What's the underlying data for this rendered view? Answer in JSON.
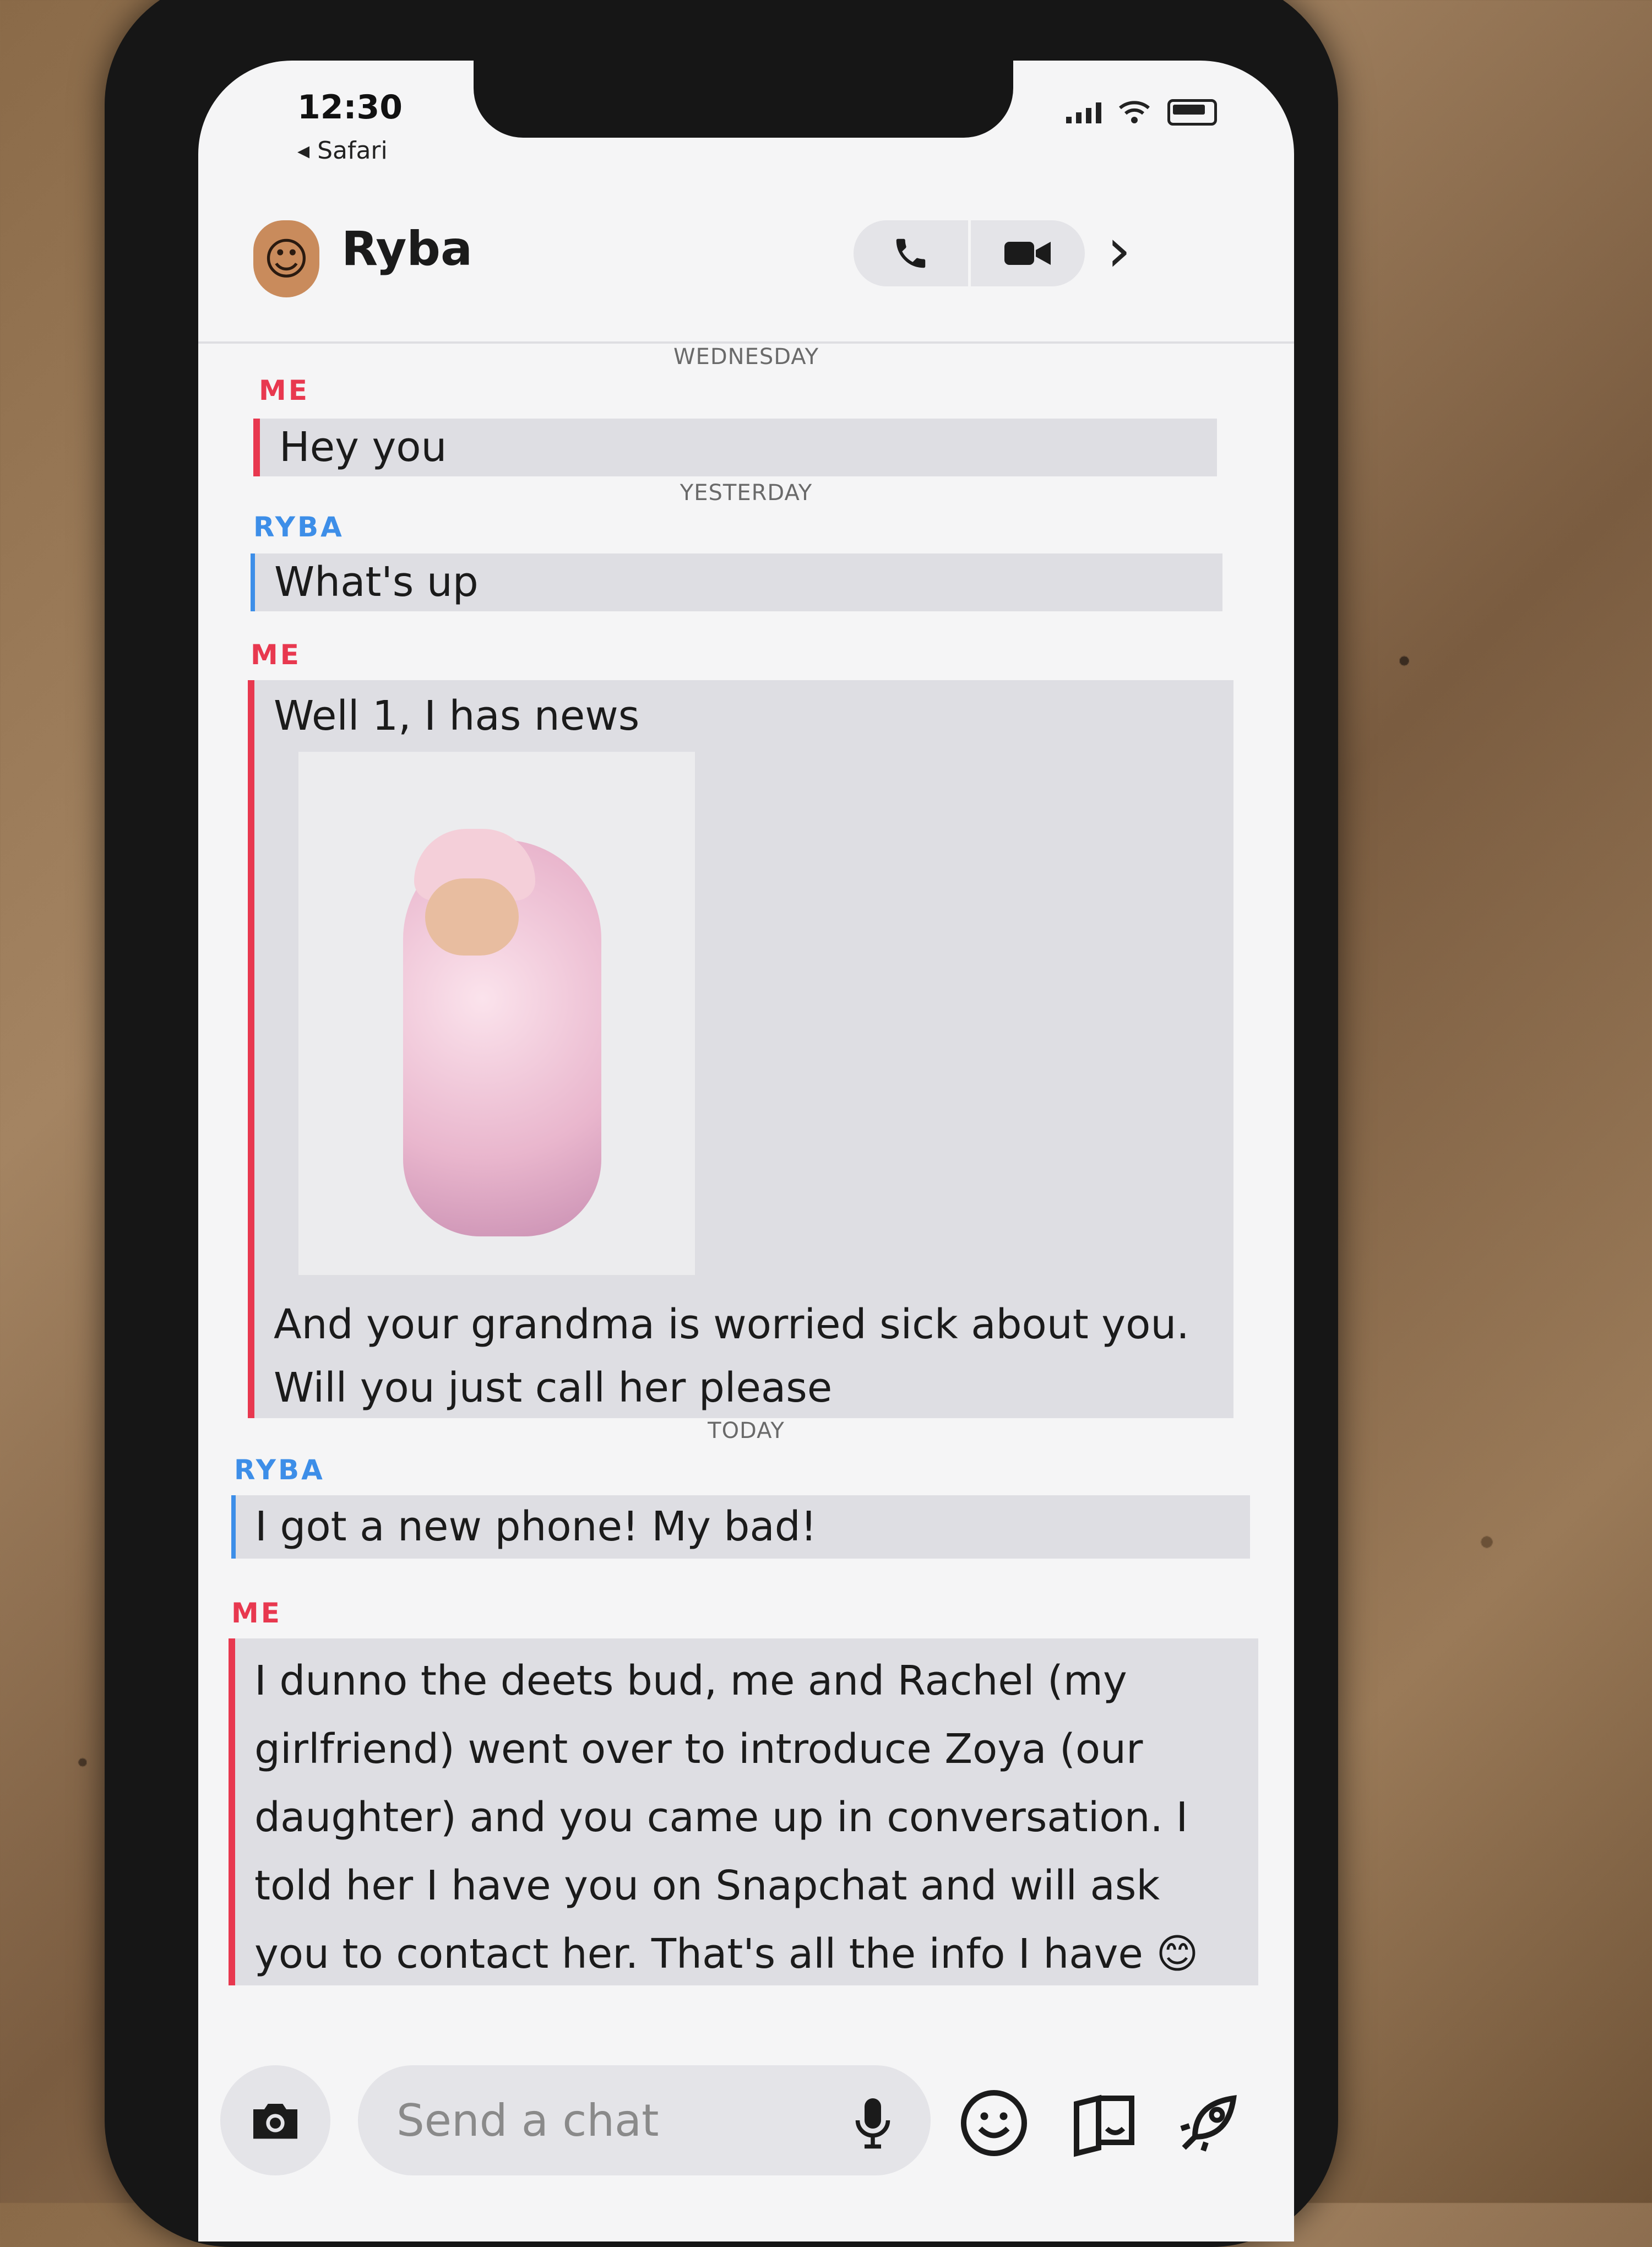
{
  "status_bar": {
    "time": "12:30",
    "back_app": "◂ Safari"
  },
  "header": {
    "contact_name": "Ryba"
  },
  "conversation": {
    "day_labels": [
      "WEDNESDAY",
      "YESTERDAY",
      "TODAY"
    ],
    "sender_me": "ME",
    "sender_ryba": "RYBA",
    "messages": [
      {
        "text": "Hey you"
      },
      {
        "text": "What's up"
      },
      {
        "lines": [
          "Well 1, I has news",
          "And your grandma is worried sick about you.",
          "Will you just call her please"
        ]
      },
      {
        "text": "I got a new phone! My bad!"
      },
      {
        "lines": [
          "I dunno the deets bud, me and Rachel (my",
          "girlfriend) went over to introduce Zoya (our",
          "daughter) and you came up in conversation. I",
          "told her I have you on Snapchat and will ask",
          "you to contact her. That's all the info I have 😊"
        ]
      }
    ]
  },
  "composer": {
    "placeholder": "Send a chat"
  },
  "colors": {
    "me": "#e8384f",
    "ryba": "#3d8ee8"
  }
}
